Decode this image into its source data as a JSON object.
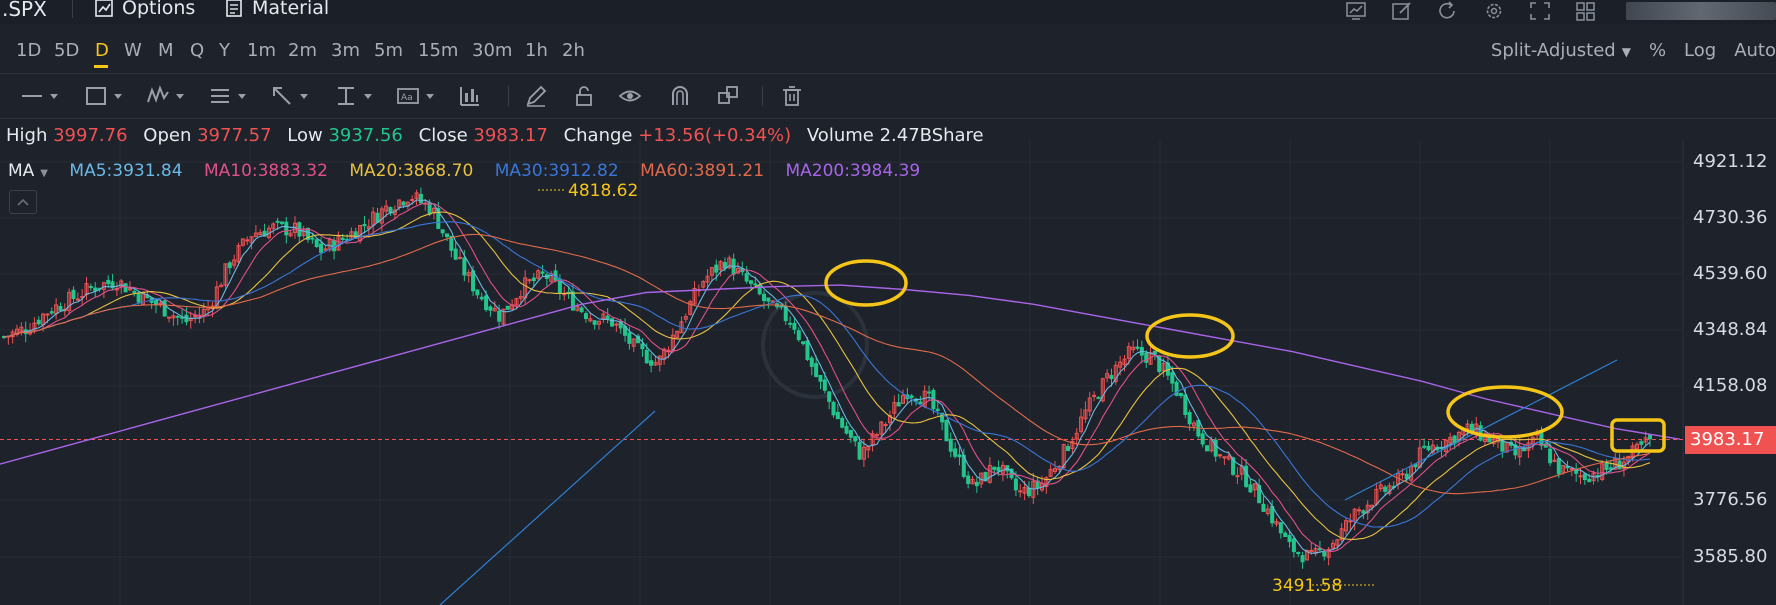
{
  "header": {
    "symbol": ".SPX",
    "options_label": "Options",
    "material_label": "Material",
    "icons": [
      "chart-settings-icon",
      "edit-icon",
      "refresh-icon",
      "gear-icon",
      "fullscreen-icon",
      "grid-layout-icon"
    ]
  },
  "periods": [
    "1D",
    "5D",
    "D",
    "W",
    "M",
    "Q",
    "Y",
    "1m",
    "2m",
    "3m",
    "5m",
    "15m",
    "30m",
    "1h",
    "2h"
  ],
  "active_period": "D",
  "right_options": {
    "adjust_label": "Split-Adjusted",
    "percent_label": "%",
    "log_label": "Log",
    "auto_label": "Auto"
  },
  "toolbar": {
    "tools": [
      "line-tool-icon",
      "rectangle-tool-icon",
      "pattern-tool-icon",
      "text-note-tool-icon",
      "arrow-tool-icon",
      "range-tool-icon",
      "text-tool-icon",
      "indicator-tool-icon",
      "pencil-icon",
      "lock-icon",
      "eye-icon",
      "magnet-icon",
      "clone-icon",
      "trash-icon"
    ]
  },
  "ohlc": {
    "high_label": "High",
    "high_value": "3997.76",
    "open_label": "Open",
    "open_value": "3977.57",
    "low_label": "Low",
    "low_value": "3937.56",
    "close_label": "Close",
    "close_value": "3983.17",
    "change_label": "Change",
    "change_value": "+13.56(+0.34%)",
    "volume_label": "Volume",
    "volume_value": "2.47BShare"
  },
  "ma": {
    "label": "MA",
    "ma5": "MA5:3931.84",
    "ma10": "MA10:3883.32",
    "ma20": "MA20:3868.70",
    "ma30": "MA30:3912.82",
    "ma60": "MA60:3891.21",
    "ma200": "MA200:3984.39"
  },
  "colors": {
    "up": "#f05252",
    "down": "#22c58c",
    "accent": "#f5c518",
    "ma5": "#6cb8e6",
    "ma10": "#e0508a",
    "ma20": "#e8c040",
    "ma30": "#3a76d8",
    "ma60": "#e26a4a",
    "ma200": "#a865e8"
  },
  "chart_data": {
    "type": "candlestick",
    "y_ticks": [
      "4921.12",
      "4730.36",
      "4539.60",
      "4348.84",
      "4158.08",
      "3776.56",
      "3585.80"
    ],
    "current_price": "3983.17",
    "annotations": {
      "high": "4818.62",
      "low": "3491.58"
    },
    "y_range": [
      3440,
      4990
    ],
    "close_series": [
      4330,
      4360,
      4420,
      4460,
      4500,
      4520,
      4470,
      4430,
      4380,
      4420,
      4580,
      4680,
      4700,
      4690,
      4620,
      4660,
      4710,
      4770,
      4810,
      4760,
      4600,
      4480,
      4400,
      4500,
      4540,
      4460,
      4400,
      4380,
      4290,
      4240,
      4380,
      4520,
      4590,
      4510,
      4430,
      4380,
      4200,
      4050,
      3930,
      4030,
      4150,
      4120,
      3960,
      3820,
      3900,
      3800,
      3830,
      3940,
      4080,
      4200,
      4280,
      4260,
      4150,
      4000,
      3920,
      3860,
      3750,
      3620,
      3580,
      3640,
      3740,
      3800,
      3850,
      3950,
      3980,
      4020,
      3980,
      3930,
      3980,
      3880,
      3860,
      3880,
      3920,
      3980
    ],
    "ma200_series": [
      3900,
      3960,
      4020,
      4080,
      4140,
      4200,
      4260,
      4320,
      4380,
      4440,
      4480,
      4490,
      4500,
      4505,
      4490,
      4470,
      4440,
      4400,
      4360,
      4320,
      4280,
      4230,
      4180,
      4120,
      4070,
      4020,
      3984
    ]
  }
}
